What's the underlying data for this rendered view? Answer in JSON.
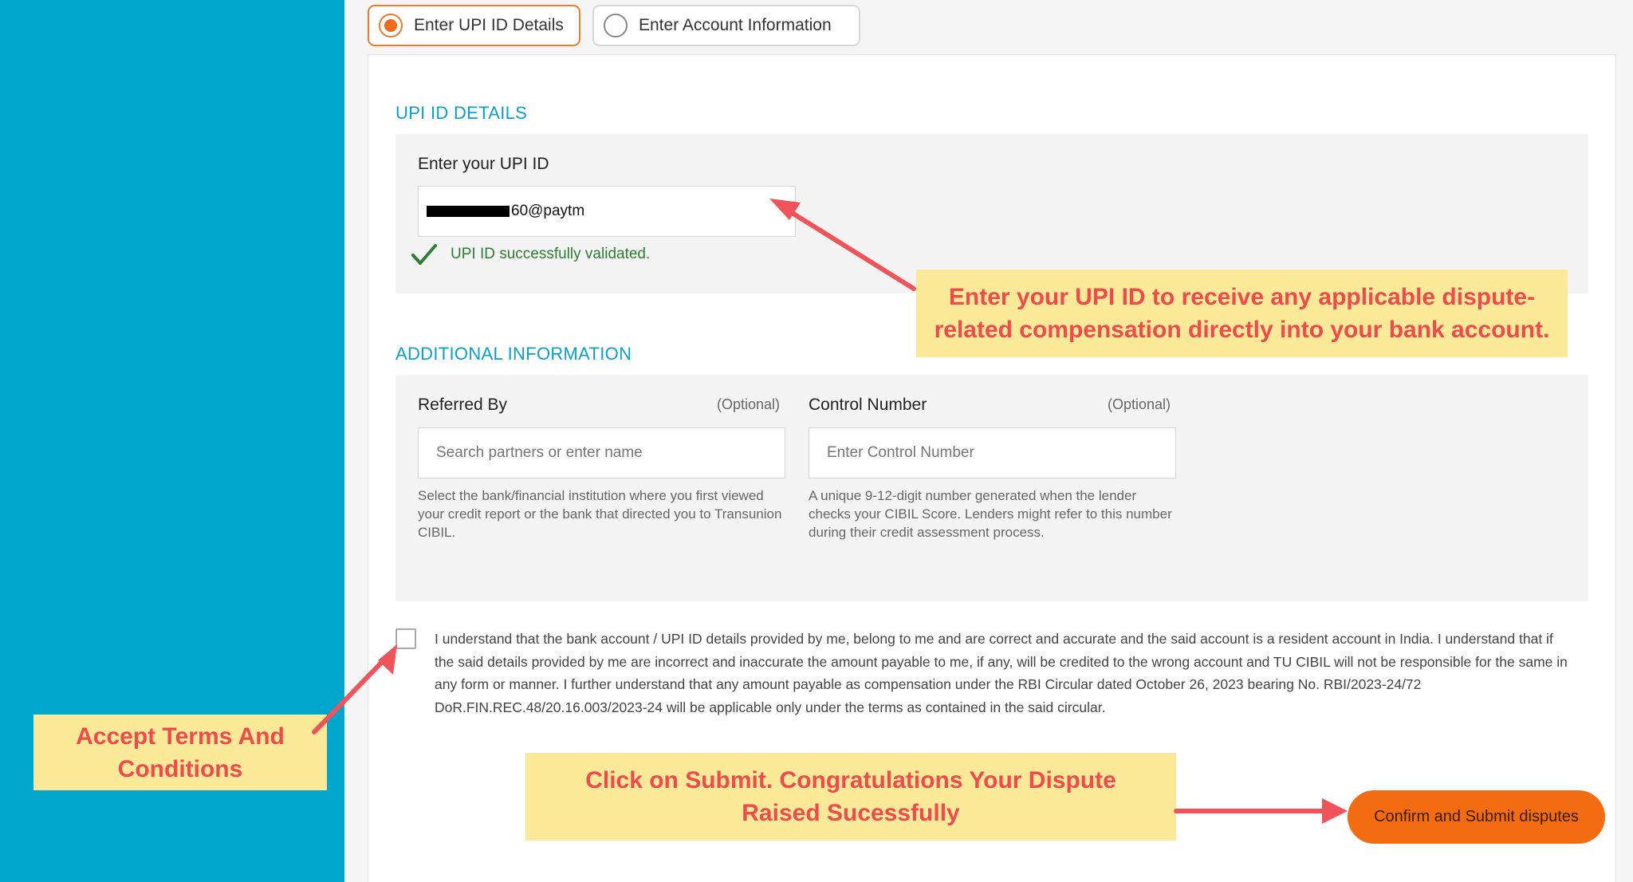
{
  "tabs": {
    "upi_label": "Enter UPI ID Details",
    "account_label": "Enter Account Information"
  },
  "upi_section": {
    "title": "UPI ID DETAILS",
    "field_label": "Enter your UPI ID",
    "value_suffix": "60@paytm",
    "validation_message": "UPI ID successfully validated."
  },
  "additional_section": {
    "title": "ADDITIONAL INFORMATION",
    "referred_by": {
      "label": "Referred By",
      "optional": "(Optional)",
      "placeholder": "Search partners or enter name",
      "help": "Select the bank/financial institution where you first viewed your credit report or the bank that directed you to Transunion CIBIL."
    },
    "control_number": {
      "label": "Control Number",
      "optional": "(Optional)",
      "placeholder": "Enter Control Number",
      "help": "A unique 9-12-digit number generated when the lender checks your CIBIL Score. Lenders might refer to this number during their credit assessment process."
    }
  },
  "terms": {
    "text": "I understand that the bank account / UPI ID details provided by me, belong to me and are correct and accurate and the said account is a resident account in India. I understand that if the said details provided by me are incorrect and inaccurate the amount payable to me, if any, will be credited to the wrong account and TU CIBIL will not be responsible for the same in any form or manner. I further understand that any amount payable as compensation under the RBI Circular dated October 26, 2023 bearing No. RBI/2023-24/72 DoR.FIN.REC.48/20.16.003/2023-24 will be applicable only under the terms as contained in the said circular."
  },
  "submit_label": "Confirm and Submit disputes",
  "callouts": {
    "upi": "Enter your UPI ID to receive any applicable dispute-related compensation directly into your bank account.",
    "terms": "Accept Terms And Conditions",
    "submit": "Click on Submit. Congratulations Your Dispute Raised Sucessfully"
  },
  "colors": {
    "sidebar": "#00a6cc",
    "accent_orange": "#f36c12",
    "section_title": "#0aa0c8",
    "callout_bg": "#fbe99a",
    "callout_text": "#ef4b4b",
    "arrow": "#f0535a",
    "success": "#2e7d32"
  },
  "icons": {
    "check": "check-icon",
    "radio_selected": "radio-selected-icon",
    "radio_empty": "radio-empty-icon"
  },
  "state": {
    "selected_tab": "upi",
    "terms_checked": false
  }
}
